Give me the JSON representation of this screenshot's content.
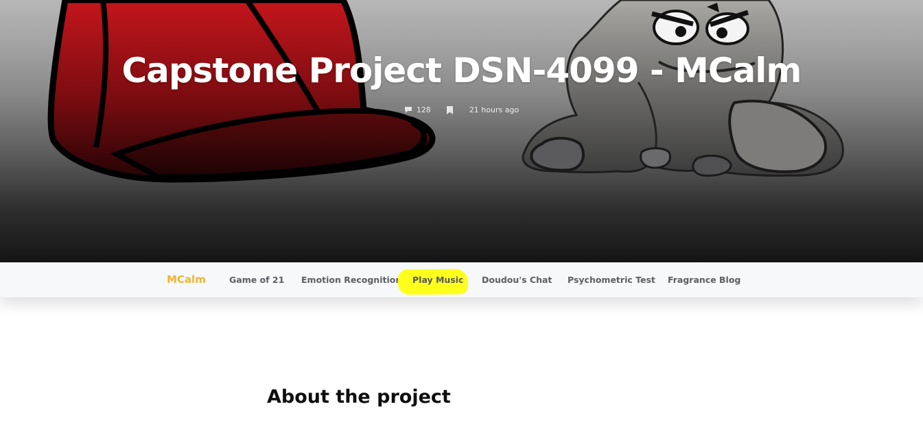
{
  "hero": {
    "title": "Capstone Project DSN-4099 - MCalm",
    "comments_count": "128",
    "time_ago": "21 hours ago",
    "icons": [
      "comment-icon",
      "bookmark-icon"
    ]
  },
  "navbar": {
    "brand": "MCalm",
    "items": [
      {
        "label": "Game of 21"
      },
      {
        "label": "Emotion Recognition"
      },
      {
        "label": "Play Music",
        "highlighted": true
      },
      {
        "label": "Doudou's Chat"
      },
      {
        "label": "Psychometric Test"
      },
      {
        "label": "Fragrance Blog"
      }
    ]
  },
  "main": {
    "section_title": "About the project"
  },
  "colors": {
    "brand": "#f1b52c",
    "highlight": "#ffff1c",
    "nav_text": "#5a5d63"
  }
}
